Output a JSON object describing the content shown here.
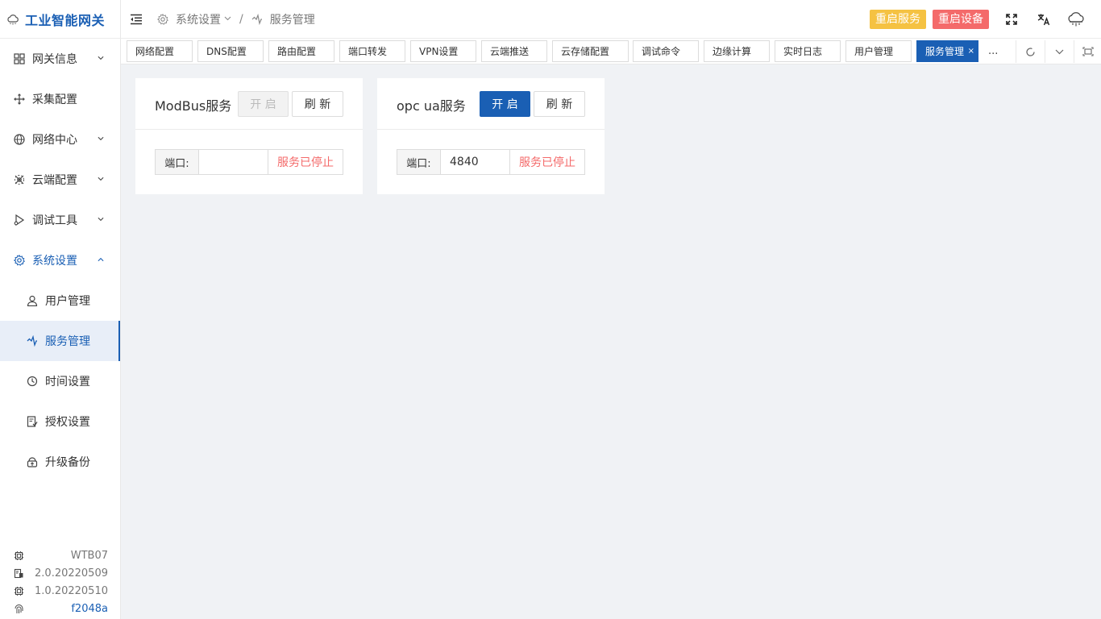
{
  "app": {
    "title": "工业智能网关"
  },
  "sidebar": {
    "items": [
      {
        "label": "网关信息",
        "icon": "grid-icon",
        "arrow": "down"
      },
      {
        "label": "采集配置",
        "icon": "move-icon",
        "arrow": ""
      },
      {
        "label": "网络中心",
        "icon": "globe-icon",
        "arrow": "down"
      },
      {
        "label": "云端配置",
        "icon": "cloud-config-icon",
        "arrow": "down"
      },
      {
        "label": "调试工具",
        "icon": "debug-icon",
        "arrow": "down"
      },
      {
        "label": "系统设置",
        "icon": "gear-icon",
        "arrow": "up"
      }
    ],
    "subitems": [
      {
        "label": "用户管理",
        "icon": "user-icon"
      },
      {
        "label": "服务管理",
        "icon": "service-icon"
      },
      {
        "label": "时间设置",
        "icon": "clock-icon"
      },
      {
        "label": "授权设置",
        "icon": "license-icon"
      },
      {
        "label": "升级备份",
        "icon": "upgrade-icon"
      }
    ],
    "info": {
      "model": "WTB07",
      "app_version": "2.0.20220509",
      "firmware_version": "1.0.20220510",
      "fingerprint": "f2048a"
    }
  },
  "header": {
    "breadcrumb": {
      "parent": "系统设置",
      "current": "服务管理",
      "separator": "/"
    },
    "restart_service": "重启服务",
    "restart_device": "重启设备"
  },
  "tabs": {
    "items": [
      "网络配置",
      "DNS配置",
      "路由配置",
      "端口转发",
      "VPN设置",
      "云端推送",
      "云存储配置",
      "调试命令",
      "边缘计算",
      "实时日志",
      "用户管理",
      "服务管理"
    ],
    "active": "服务管理",
    "more": "...",
    "close": "×"
  },
  "cards": {
    "modbus": {
      "title": "ModBus服务",
      "start": "开 启",
      "refresh": "刷 新",
      "port_label": "端口:",
      "port_value": "",
      "status": "服务已停止"
    },
    "opcua": {
      "title": "opc ua服务",
      "start": "开 启",
      "refresh": "刷 新",
      "port_label": "端口:",
      "port_value": "4840",
      "status": "服务已停止"
    }
  },
  "colors": {
    "primary": "#1a5fb4",
    "warning": "#f5c242",
    "danger": "#f46a6a",
    "background": "#f0f2f5"
  }
}
